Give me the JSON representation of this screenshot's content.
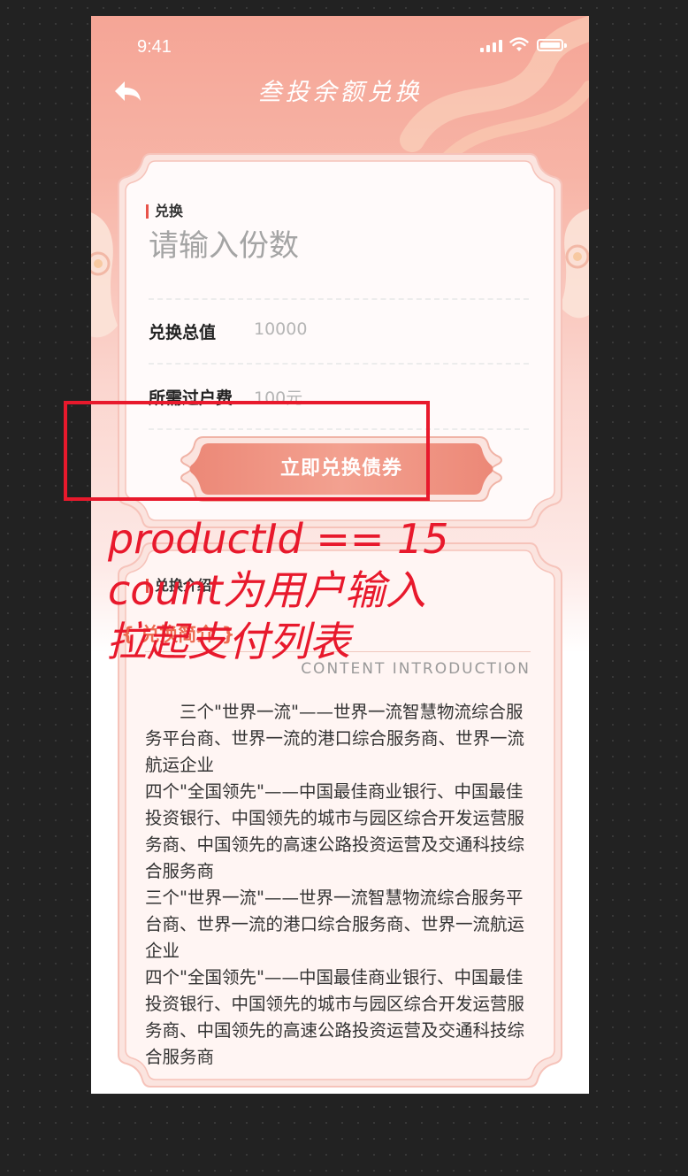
{
  "status_bar": {
    "time": "9:41"
  },
  "nav": {
    "title": "叁投余额兑换"
  },
  "exchange_card": {
    "section_label": "兑换",
    "amount_input": {
      "placeholder": "请输入份数",
      "value": ""
    },
    "total_label": "兑换总值",
    "total_value": "10000",
    "fee_label": "所需过户费",
    "fee_value": "100元",
    "submit_label": "立即兑换债券"
  },
  "intro_card": {
    "section_label": "兑换介绍",
    "brief_title": "{ 兑换简介 }",
    "brief_subtitle": "CONTENT INTRODUCTION",
    "paragraphs": [
      "　　三个\"世界一流\"——世界一流智慧物流综合服务平台商、世界一流的港口综合服务商、世界一流航运企业",
      "四个\"全国领先\"——中国最佳商业银行、中国最佳投资银行、中国领先的城市与园区综合开发运营服务商、中国领先的高速公路投资运营及交通科技综合服务商",
      "三个\"世界一流\"——世界一流智慧物流综合服务平台商、世界一流的港口综合服务商、世界一流航运企业",
      "四个\"全国领先\"——中国最佳商业银行、中国最佳投资银行、中国领先的城市与园区综合开发运营服务商、中国领先的高速公路投资运营及交通科技综合服务商"
    ]
  },
  "annotation": {
    "lines": [
      "productId == 15",
      "count为用户输入",
      "拉起支付列表"
    ],
    "color": "#e8192c"
  },
  "colors": {
    "accent": "#e8534a",
    "button": "#ef8d7c",
    "annotation": "#e8192c"
  }
}
